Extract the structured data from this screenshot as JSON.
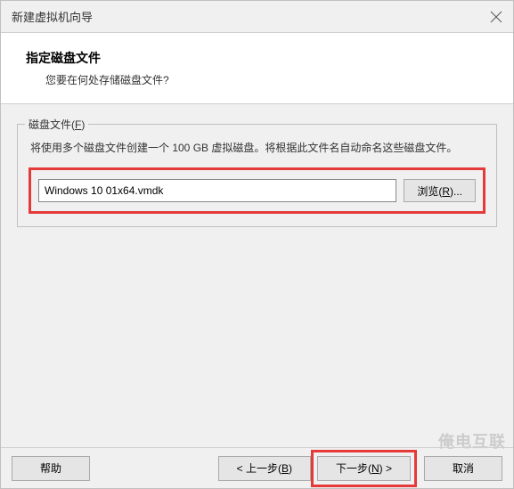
{
  "window": {
    "title": "新建虚拟机向导"
  },
  "header": {
    "title": "指定磁盘文件",
    "subtitle": "您要在何处存储磁盘文件?"
  },
  "fieldset": {
    "legend_prefix": "磁盘文件(",
    "legend_key": "F",
    "legend_suffix": ")",
    "description": "将使用多个磁盘文件创建一个 100 GB 虚拟磁盘。将根据此文件名自动命名这些磁盘文件。"
  },
  "input": {
    "value": "Windows 10 01x64.vmdk"
  },
  "buttons": {
    "browse_prefix": "浏览(",
    "browse_key": "R",
    "browse_suffix": ")...",
    "help": "帮助",
    "back_prefix": "< 上一步(",
    "back_key": "B",
    "back_suffix": ")",
    "next_prefix": "下一步(",
    "next_key": "N",
    "next_suffix": ") >",
    "cancel": "取消"
  },
  "watermark": "俺电互联"
}
